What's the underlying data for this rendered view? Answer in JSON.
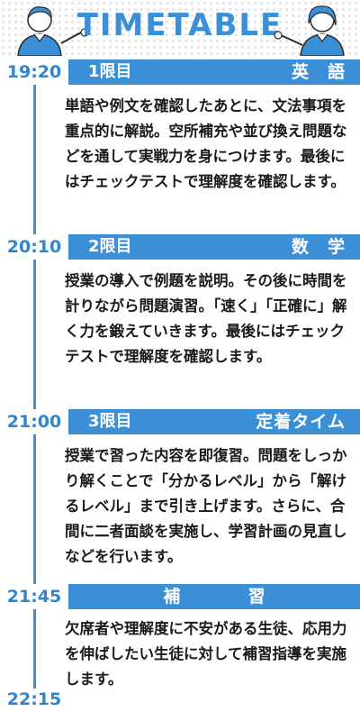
{
  "title": "TIMETABLE",
  "colors": {
    "accent": "#3a8fd6",
    "text": "#1a1a1a"
  },
  "rows": [
    {
      "time": "19:20",
      "period": "1限目",
      "subject": "英　語",
      "description": "単語や例文を確認したあとに、文法事項を重点的に解説。空所補充や並び換え問題などを通して実戦力を身につけます。最後にはチェックテストで理解度を確認します。"
    },
    {
      "time": "20:10",
      "period": "2限目",
      "subject": "数　学",
      "description": "授業の導入で例題を説明。その後に時間を計りながら問題演習。「速く」「正確に」解く力を鍛えていきます。最後にはチェックテストで理解度を確認します。"
    },
    {
      "time": "21:00",
      "period": "3限目",
      "subject": "定着タイム",
      "description": "授業で習った内容を即復習。問題をしっかり解くことで「分かるレベル」から「解けるレベル」まで引き上げます。さらに、合間に二者面談を実施し、学習計画の見直しなどを行います。"
    },
    {
      "time": "21:45",
      "period": "",
      "subject": "補　習",
      "description": "欠席者や理解度に不安がある生徒、応用力を伸ばしたい生徒に対して補習指導を実施します。"
    }
  ],
  "end_time": "22:15"
}
